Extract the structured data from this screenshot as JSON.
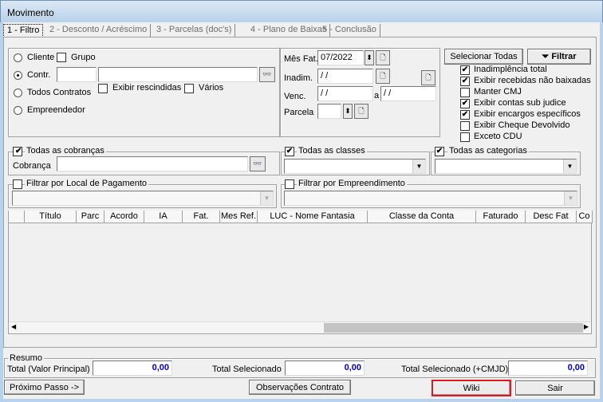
{
  "window": {
    "title": "Movimento"
  },
  "tabs": [
    "1 - Filtro",
    "2 - Desconto / Acréscimo",
    "3 - Parcelas (doc's)",
    "4 - Plano de Baixas",
    "5 - Conclusão"
  ],
  "filter": {
    "cliente": "Cliente",
    "grupo": "Grupo",
    "contr": "Contr.",
    "exibir_rescindidas": "Exibir rescindidas",
    "varios": "Vários",
    "todos_contratos": "Todos Contratos",
    "empreendedor": "Empreendedor",
    "selected_radio": "Contr."
  },
  "dates": {
    "mes_fat_label": "Mês Fat.",
    "mes_fat_value": "07/2022",
    "inadim_label": "Inadim.",
    "inadim_value": " /  /",
    "venc_label": "Venc.",
    "venc_from": " /  /",
    "venc_a": "a",
    "venc_to": " /  /",
    "parcela_label": "Parcela",
    "parcela_value": ""
  },
  "buttons": {
    "selecionar_todas": "Selecionar Todas",
    "filtrar": "Filtrar",
    "proximo": "Próximo Passo ->",
    "observacoes": "Observações Contrato",
    "wiki": "Wiki",
    "sair": "Sair"
  },
  "options": [
    {
      "label": "Inadimplência total",
      "checked": true
    },
    {
      "label": "Exibir recebidas não baixadas",
      "checked": true
    },
    {
      "label": "Manter CMJ",
      "checked": false
    },
    {
      "label": "Exibir contas sub judice",
      "checked": true
    },
    {
      "label": "Exibir encargos específicos",
      "checked": true
    },
    {
      "label": "Exibir Cheque Devolvido",
      "checked": false
    },
    {
      "label": "Exceto CDU",
      "checked": false
    }
  ],
  "groups": {
    "todas_cobrancas": "Todas as cobranças",
    "cobranca": "Cobrança",
    "todas_classes": "Todas as classes",
    "todas_categorias": "Todas as categorias",
    "local_pagamento": "Filtrar por Local de Pagamento",
    "empreendimento": "Filtrar por Empreendimento"
  },
  "grid": {
    "columns": [
      "",
      "Título",
      "Parc",
      "Acordo",
      "IA",
      "Fat.",
      "Mes Ref.",
      "LUC - Nome Fantasia",
      "Classe da Conta",
      "Faturado",
      "Desc Fat",
      "Co"
    ],
    "rows": []
  },
  "resumo": {
    "title": "Resumo",
    "total_label": "Total (Valor Principal)",
    "total": "0,00",
    "sel_label": "Total Selecionado",
    "sel": "0,00",
    "selcmjd_label": "Total Selecionado (+CMJD)",
    "selcmjd": "0,00"
  },
  "colors": {
    "highlight": "#e8141c",
    "value": "#0000d0"
  }
}
